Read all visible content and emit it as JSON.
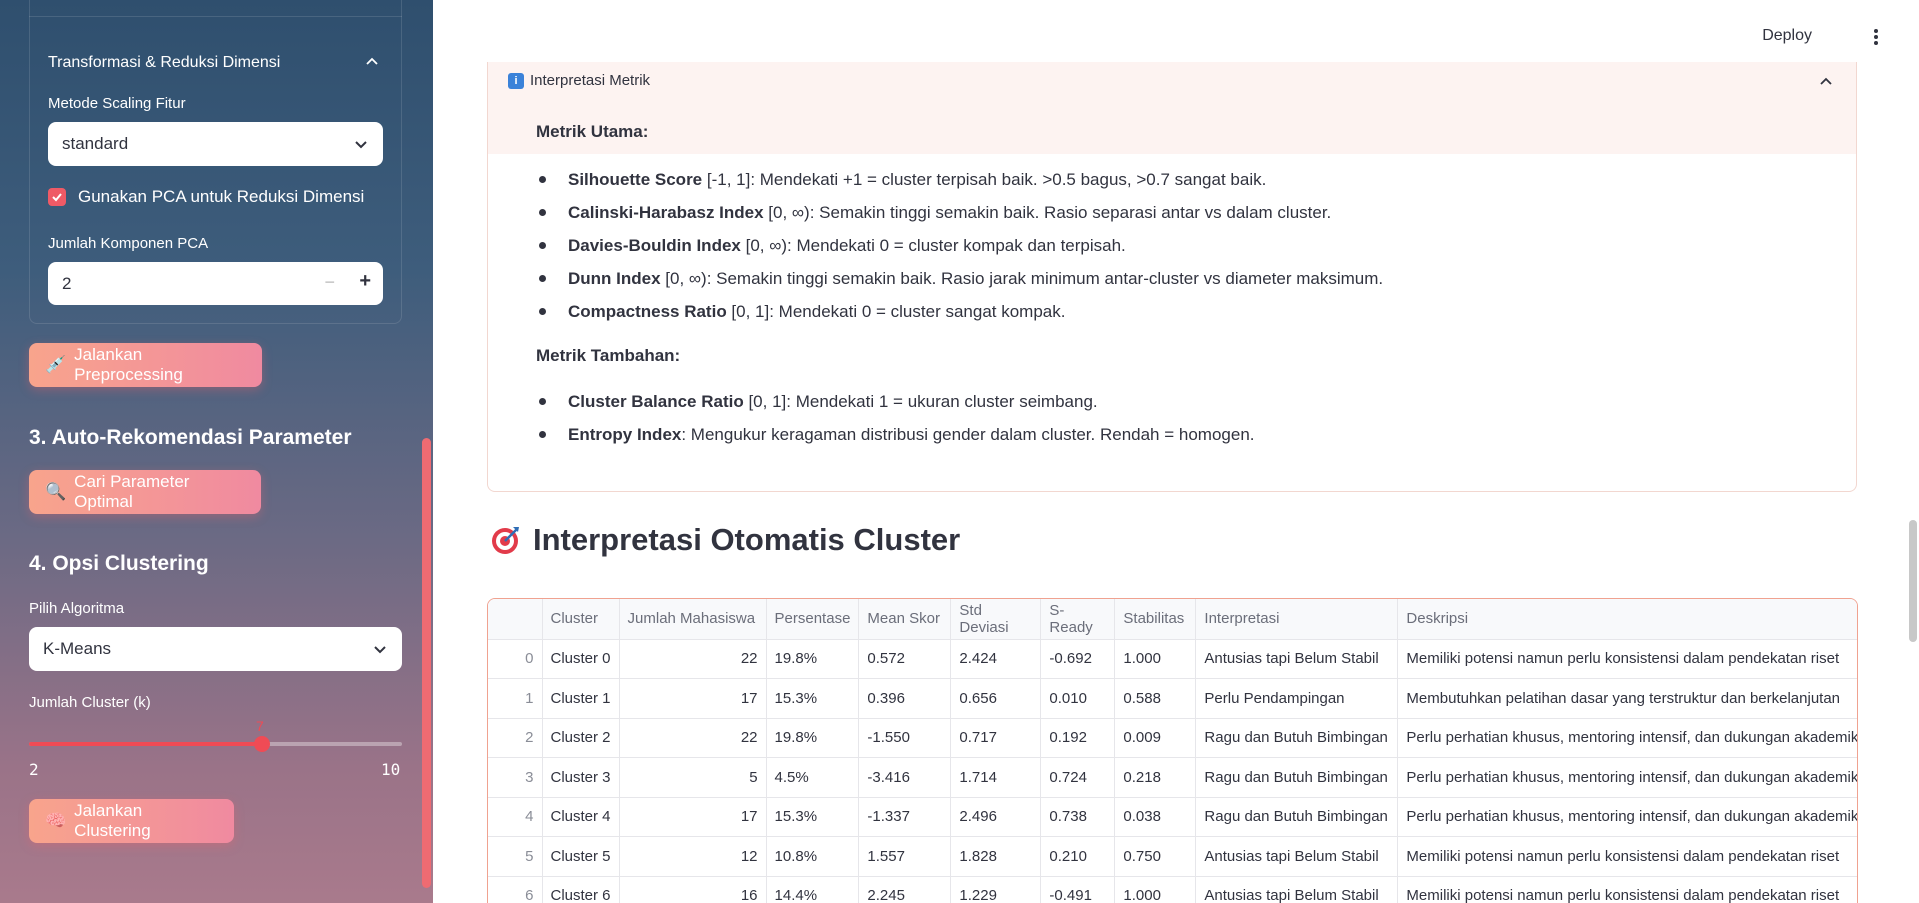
{
  "sidebar": {
    "expander_title": "Transformasi & Reduksi Dimensi",
    "scaling_label": "Metode Scaling Fitur",
    "scaling_value": "standard",
    "pca_checkbox_label": "Gunakan PCA untuk Reduksi Dimensi",
    "pca_checked": true,
    "pca_components_label": "Jumlah Komponen PCA",
    "pca_components_value": "2",
    "preprocess_button": "Jalankan Preprocessing",
    "section3_title": "3. Auto-Rekomendasi Parameter",
    "search_button": "Cari Parameter Optimal",
    "section4_title": "4. Opsi Clustering",
    "algorithm_label": "Pilih Algoritma",
    "algorithm_value": "K-Means",
    "k_label": "Jumlah Cluster (k)",
    "k_value": "7",
    "k_min": "2",
    "k_max": "10",
    "k_fraction": 0.625,
    "cluster_button": "Jalankan Clustering"
  },
  "header": {
    "deploy_label": "Deploy"
  },
  "metrics": {
    "expander_title": "Interpretasi Metrik",
    "main_heading": "Metrik Utama:",
    "main_items": [
      {
        "name": "Silhouette Score",
        "desc": " [-1, 1]: Mendekati +1 = cluster terpisah baik. >0.5 bagus, >0.7 sangat baik."
      },
      {
        "name": "Calinski-Harabasz Index",
        "desc": " [0, ∞): Semakin tinggi semakin baik. Rasio separasi antar vs dalam cluster."
      },
      {
        "name": "Davies-Bouldin Index",
        "desc": " [0, ∞): Mendekati 0 = cluster kompak dan terpisah."
      },
      {
        "name": "Dunn Index",
        "desc": " [0, ∞): Semakin tinggi semakin baik. Rasio jarak minimum antar-cluster vs diameter maksimum."
      },
      {
        "name": "Compactness Ratio",
        "desc": " [0, 1]: Mendekati 0 = cluster sangat kompak."
      }
    ],
    "extra_heading": "Metrik Tambahan:",
    "extra_items": [
      {
        "name": "Cluster Balance Ratio",
        "desc": " [0, 1]: Mendekati 1 = ukuran cluster seimbang."
      },
      {
        "name": "Entropy Index",
        "desc": ": Mengukur keragaman distribusi gender dalam cluster. Rendah = homogen."
      }
    ]
  },
  "interpretation": {
    "title": "Interpretasi Otomatis Cluster",
    "columns": [
      "",
      "Cluster",
      "Jumlah Mahasiswa",
      "Persentase",
      "Mean Skor",
      "Std Deviasi",
      "S-Ready",
      "Stabilitas",
      "Interpretasi",
      "Deskripsi"
    ],
    "rows": [
      [
        "0",
        "Cluster 0",
        "22",
        "19.8%",
        "0.572",
        "2.424",
        "-0.692",
        "1.000",
        "Antusias tapi Belum Stabil",
        "Memiliki potensi namun perlu konsistensi dalam pendekatan riset"
      ],
      [
        "1",
        "Cluster 1",
        "17",
        "15.3%",
        "0.396",
        "0.656",
        "0.010",
        "0.588",
        "Perlu Pendampingan",
        "Membutuhkan pelatihan dasar yang terstruktur dan berkelanjutan"
      ],
      [
        "2",
        "Cluster 2",
        "22",
        "19.8%",
        "-1.550",
        "0.717",
        "0.192",
        "0.009",
        "Ragu dan Butuh Bimbingan",
        "Perlu perhatian khusus, mentoring intensif, dan dukungan akademik"
      ],
      [
        "3",
        "Cluster 3",
        "5",
        "4.5%",
        "-3.416",
        "1.714",
        "0.724",
        "0.218",
        "Ragu dan Butuh Bimbingan",
        "Perlu perhatian khusus, mentoring intensif, dan dukungan akademik"
      ],
      [
        "4",
        "Cluster 4",
        "17",
        "15.3%",
        "-1.337",
        "2.496",
        "0.738",
        "0.038",
        "Ragu dan Butuh Bimbingan",
        "Perlu perhatian khusus, mentoring intensif, dan dukungan akademik"
      ],
      [
        "5",
        "Cluster 5",
        "12",
        "10.8%",
        "1.557",
        "1.828",
        "0.210",
        "0.750",
        "Antusias tapi Belum Stabil",
        "Memiliki potensi namun perlu konsistensi dalam pendekatan riset"
      ],
      [
        "6",
        "Cluster 6",
        "16",
        "14.4%",
        "2.245",
        "1.229",
        "-0.491",
        "1.000",
        "Antusias tapi Belum Stabil",
        "Memiliki potensi namun perlu konsistensi dalam pendekatan riset"
      ]
    ]
  }
}
